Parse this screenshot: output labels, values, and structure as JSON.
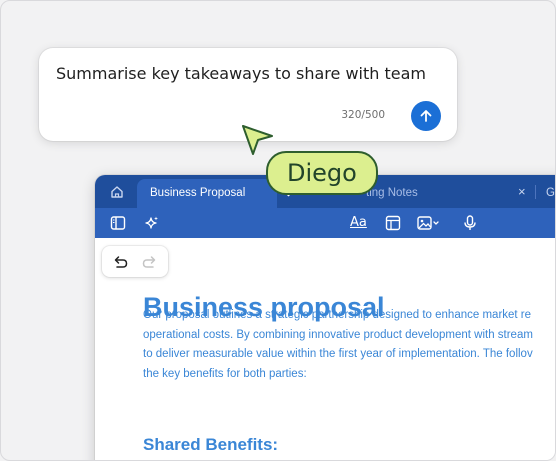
{
  "prompt": {
    "text": "Summarise key takeaways to share with team",
    "char_count": "320/500",
    "send_icon": "arrow-up-icon",
    "accent": "#1b6fd6"
  },
  "collaborator": {
    "name": "Diego",
    "cursor_icon": "pointer-cursor-icon",
    "tag_color": "#dcef8f"
  },
  "tabs": {
    "home_icon": "home-icon",
    "active_label": "Business Proposal",
    "inactive_label": "ting Notes",
    "close_label": "×",
    "next_label": "G"
  },
  "toolbar": {
    "sidebar_icon": "sidebar-icon",
    "ai_icon": "sparkle-icon",
    "font_label": "Aa",
    "layout_icon": "layout-icon",
    "image_icon": "image-icon",
    "mic_icon": "microphone-icon"
  },
  "history": {
    "undo_icon": "undo-icon",
    "redo_icon": "redo-icon"
  },
  "document": {
    "title": "Business proposal",
    "body_lines": [
      "Our proposal outlines a strategic partnership designed to enhance market re",
      "operational costs. By combining innovative product development with stream",
      "to deliver measurable value within the first year of implementation. The follov",
      "the key benefits for both parties:"
    ],
    "subheading": "Shared Benefits:",
    "text_color": "#3a86d6"
  },
  "colors": {
    "tab_bar": "#1f4e9c",
    "toolbar": "#2e62bb"
  }
}
